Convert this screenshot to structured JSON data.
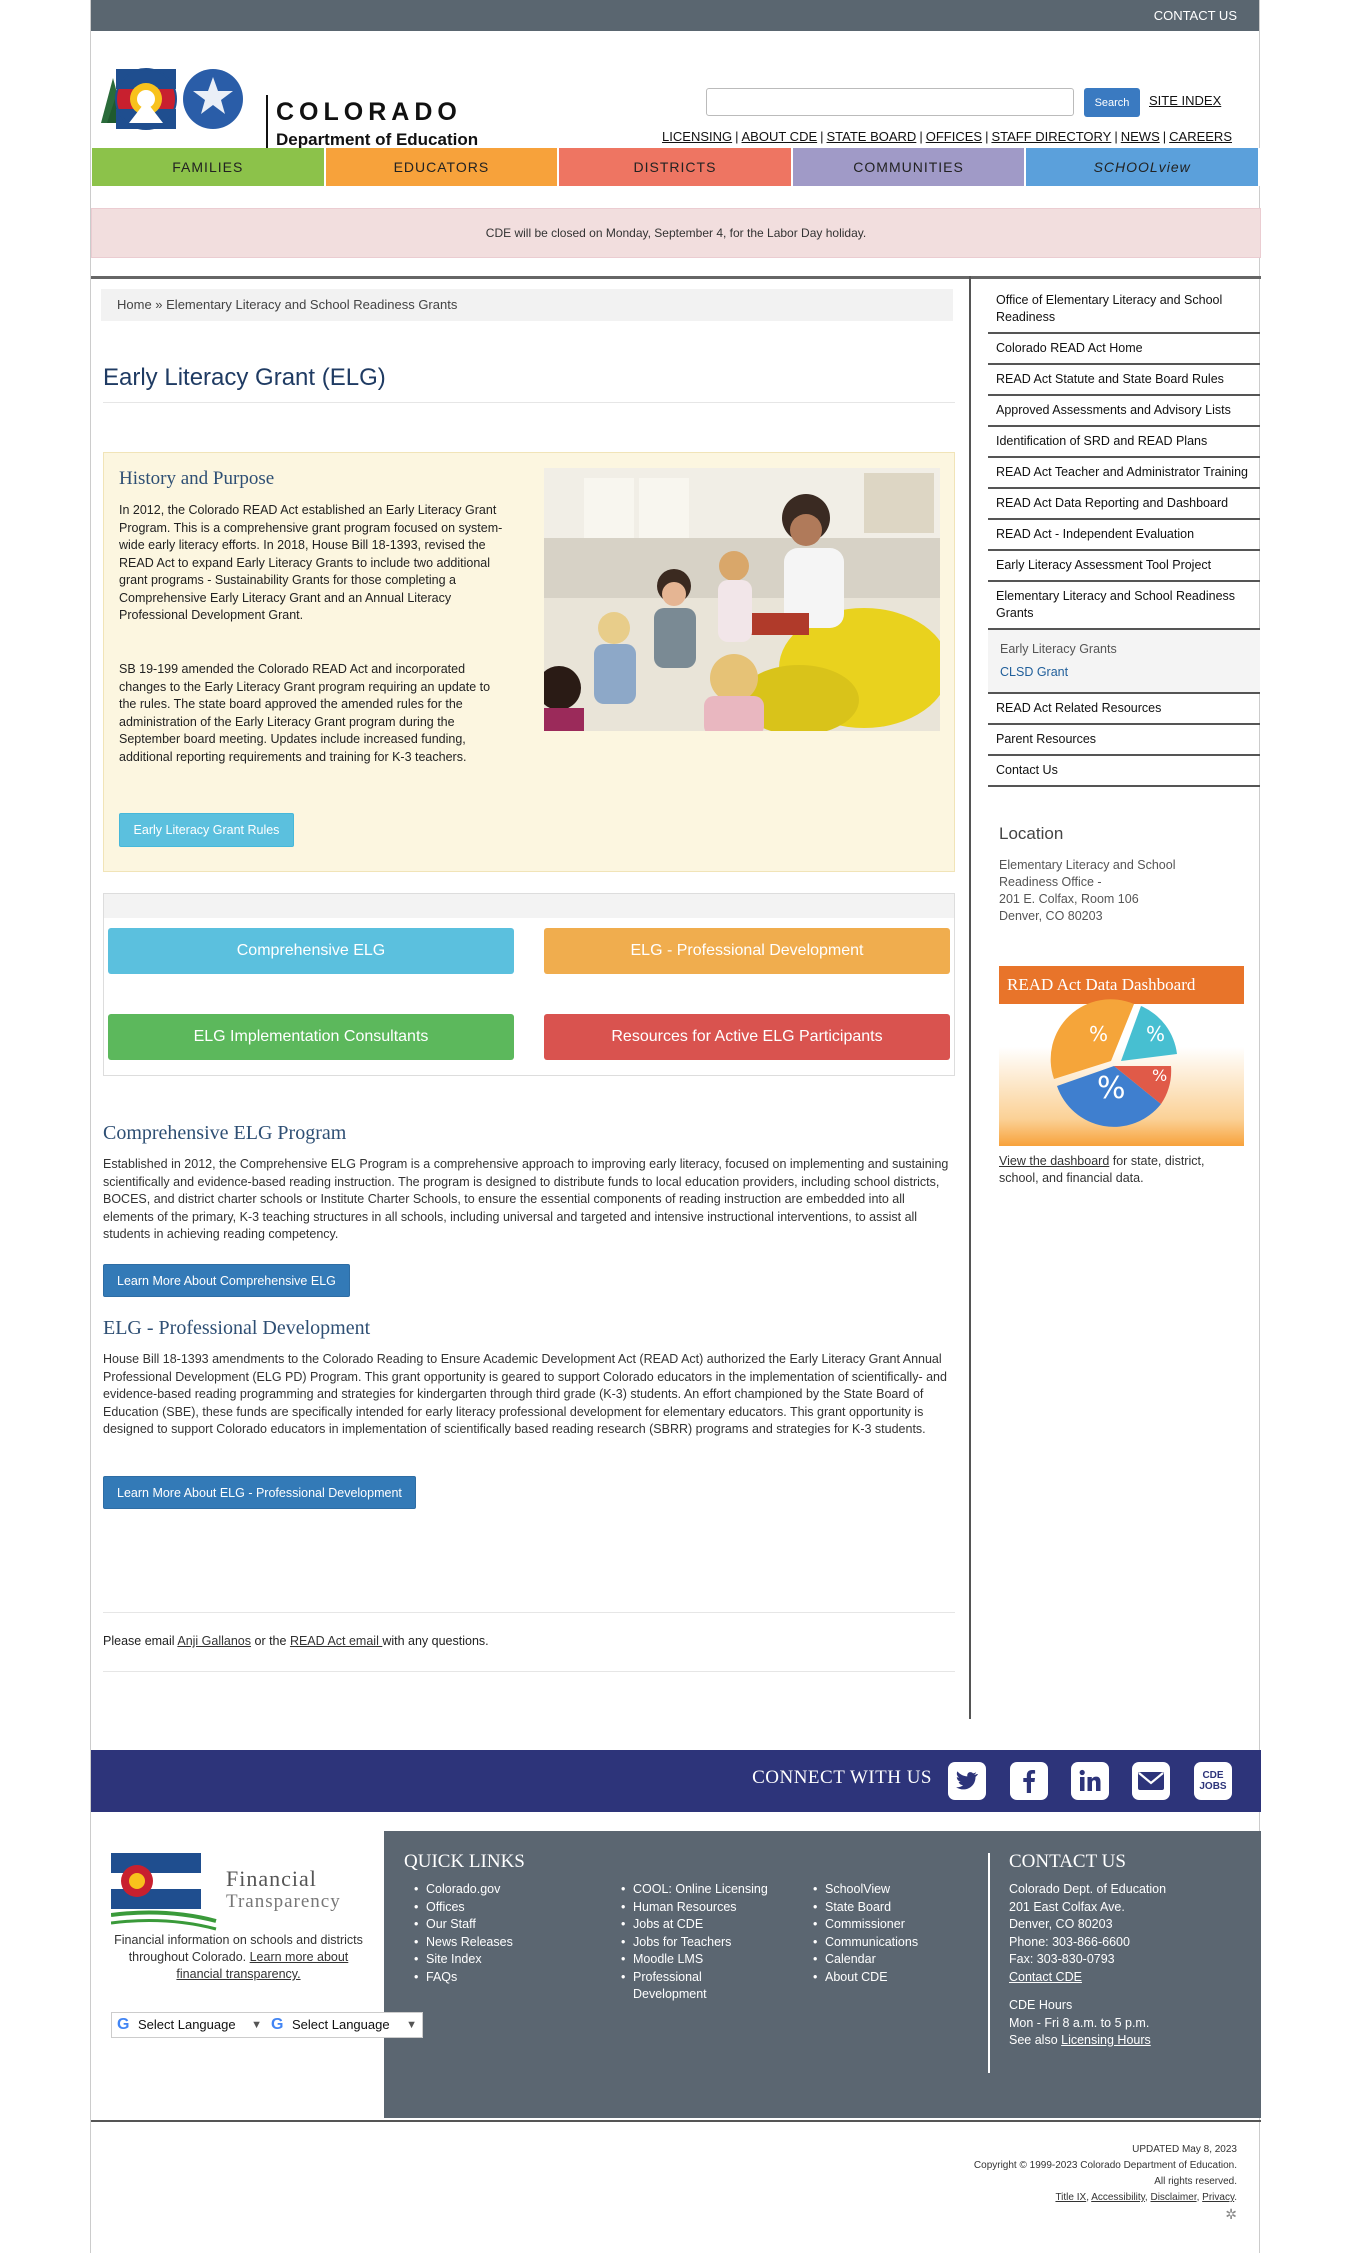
{
  "topbar": {
    "contact": "CONTACT US"
  },
  "header": {
    "org_title": "COLORADO",
    "org_subtitle": "Department of Education",
    "cde_badge": "CDE",
    "search_placeholder": "",
    "search_button": "Search",
    "site_index": "SITE INDEX",
    "utility_links": [
      "LICENSING",
      "ABOUT CDE",
      "STATE BOARD",
      "OFFICES",
      "STAFF DIRECTORY",
      "NEWS",
      "CAREERS"
    ]
  },
  "nav": {
    "families": "FAMILIES",
    "educators": "EDUCATORS",
    "districts": "DISTRICTS",
    "communities": "COMMUNITIES",
    "schoolview": "SCHOOLview"
  },
  "alert": "CDE will be closed on Monday, September 4, for the Labor Day holiday.",
  "breadcrumb": "Home » Elementary Literacy and School Readiness Grants",
  "page_title": "Early Literacy Grant (ELG)",
  "history": {
    "title": "History and Purpose",
    "p1": "In 2012, the Colorado READ Act established an Early Literacy Grant Program. This is a comprehensive grant program focused on system-wide early literacy efforts. In 2018, House Bill 18-1393, revised the READ Act to expand Early Literacy Grants to include two additional grant programs - Sustainability Grants for those completing a Comprehensive Early Literacy Grant and an Annual Literacy Professional Development Grant.",
    "p2": "SB 19-199 amended the Colorado READ Act and incorporated changes to the Early Literacy Grant program requiring an update to the rules. The state board approved the amended rules for the administration of the Early Literacy Grant program during the September board meeting. Updates include increased funding, additional reporting requirements and training for K-3 teachers.",
    "rules_button": "Early Literacy Grant Rules"
  },
  "buttons": {
    "comprehensive": "Comprehensive ELG",
    "prof_dev": "ELG - Professional Development",
    "consultants": "ELG Implementation Consultants",
    "resources": "Resources for Active ELG Participants"
  },
  "comprehensive": {
    "title": "Comprehensive ELG Program",
    "text": "Established in 2012, the Comprehensive ELG Program is a comprehensive approach to improving early literacy, focused on implementing and sustaining scientifically and evidence-based reading instruction. The program is designed to distribute funds to local education providers, including school districts, BOCES, and district charter schools or Institute Charter Schools, to ensure the essential components of reading instruction are embedded into all elements of the primary, K-3 teaching structures in all schools, including universal and targeted and intensive instructional interventions, to assist all students in achieving reading competency.",
    "button": "Learn More About Comprehensive ELG"
  },
  "profdev": {
    "title": "ELG - Professional Development",
    "text": "House Bill 18-1393 amendments to the Colorado Reading to Ensure Academic Development Act (READ Act) authorized the Early Literacy Grant Annual Professional Development (ELG PD) Program. This grant opportunity is geared to support Colorado educators in the implementation of scientifically- and evidence-based reading programming and strategies for kindergarten through third grade (K-3) students. An effort championed by the State Board of Education (SBE), these funds are specifically intended for early literacy professional development for elementary educators. This grant opportunity is designed to support Colorado educators in implementation of scientifically based reading research (SBRR) programs and strategies for K-3 students.",
    "button": "Learn More About ELG - Professional Development"
  },
  "contact_line": {
    "prefix": "Please email ",
    "name": "Anji Gallanos",
    "middle": " or the ",
    "link": "READ Act email ",
    "suffix": " with any questions."
  },
  "sidebar": {
    "items": [
      "Office of Elementary Literacy and School Readiness",
      "Colorado READ Act Home",
      "READ Act Statute and State Board Rules",
      "Approved Assessments and Advisory Lists",
      "Identification of SRD and READ Plans",
      "READ Act Teacher and Administrator Training",
      "READ Act Data Reporting and Dashboard",
      "READ Act - Independent Evaluation",
      "Early Literacy Assessment Tool Project",
      "Elementary Literacy and School Readiness Grants"
    ],
    "sub_items": [
      "Early Literacy Grants",
      "CLSD Grant"
    ],
    "items_after": [
      "READ Act Related Resources",
      "Parent Resources",
      "Contact Us"
    ]
  },
  "location": {
    "title": "Location",
    "line1": "Elementary Literacy and School Readiness Office -",
    "line2": "201 E. Colfax, Room 106",
    "line3": "Denver, CO 80203"
  },
  "dashboard": {
    "title": "READ Act Data Dashboard",
    "link": "View the dashboard",
    "text": " for state, district, school, and financial data.",
    "pct": "%"
  },
  "connect": {
    "label": "CONNECT WITH US",
    "icons": [
      "twitter-icon",
      "facebook-icon",
      "linkedin-icon",
      "email-icon",
      "cde-jobs-icon"
    ],
    "jobs_top": "CDE",
    "jobs_bottom": "JOBS"
  },
  "footer": {
    "fin_title": "Financial",
    "fin_sub": "Transparency",
    "fin_text": "Financial information on schools and districts throughout Colorado. ",
    "fin_link": "Learn more about financial transparency.",
    "lang1": "Select Language",
    "lang2": "Select Language",
    "quick_links_title": "QUICK LINKS",
    "col1": [
      "Colorado.gov",
      "Offices",
      "Our Staff",
      "News Releases",
      "Site Index",
      "FAQs"
    ],
    "col2": [
      "COOL: Online Licensing",
      "Human Resources",
      "Jobs at CDE",
      "Jobs for Teachers",
      "Moodle LMS",
      "Professional Development"
    ],
    "col3": [
      "SchoolView",
      "State Board",
      "Commissioner",
      "Communications",
      "Calendar",
      "About CDE"
    ],
    "contact_title": "CONTACT US",
    "contact_lines": [
      "Colorado Dept. of Education",
      "201 East Colfax Ave.",
      "Denver, CO 80203",
      "Phone: 303-866-6600",
      "Fax: 303-830-0793"
    ],
    "contact_link": "Contact CDE",
    "hours_title": "CDE Hours",
    "hours": "Mon - Fri 8 a.m. to 5 p.m.",
    "see_also": "See also ",
    "licensing_hours": "Licensing Hours"
  },
  "legal": {
    "updated": "UPDATED May 8, 2023",
    "copyright": "Copyright © 1999-2023 Colorado Department of Education.",
    "rights": "All rights reserved.",
    "links": [
      "Title IX",
      "Accessibility",
      "Disclaimer",
      "Privacy"
    ]
  }
}
